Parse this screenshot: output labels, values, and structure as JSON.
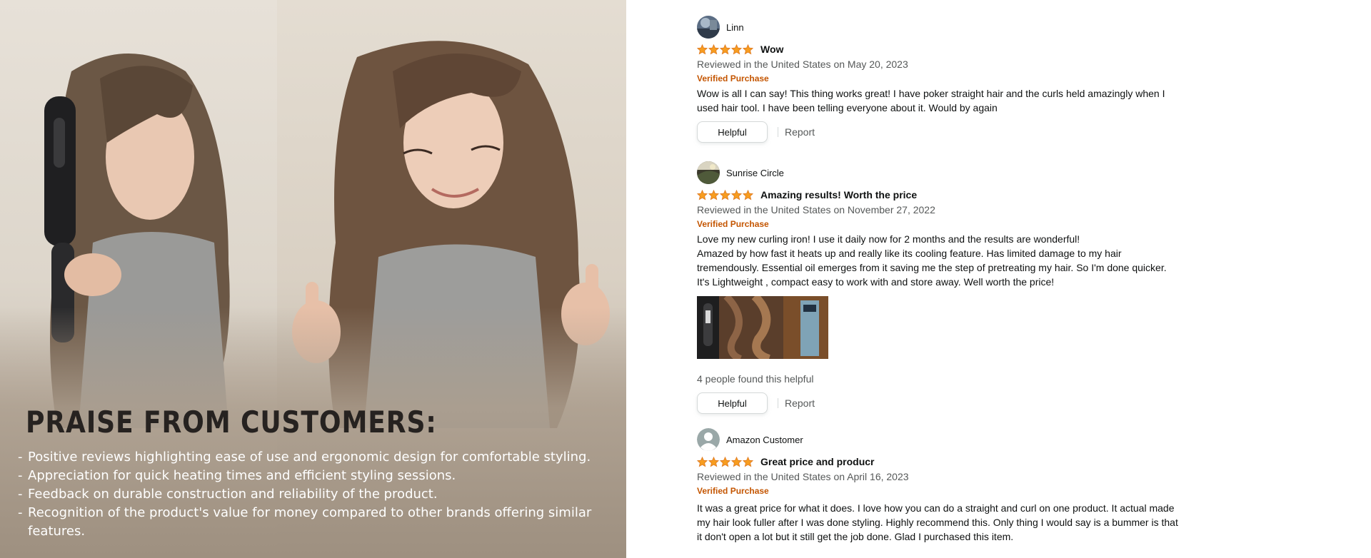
{
  "promo": {
    "title": "PRAISE FROM CUSTOMERS:",
    "points": [
      "Positive reviews highlighting ease of use and ergonomic design for comfortable styling.",
      "Appreciation for quick heating times and efficient styling sessions.",
      "Feedback on durable construction and reliability of the product.",
      "Recognition of the product's value for money compared to other brands offering similar features."
    ]
  },
  "colors": {
    "star": "#f79d20",
    "verified": "#c45500",
    "muted_text": "#565959",
    "button_border": "#d5d9d9"
  },
  "reviews": [
    {
      "profile_name": "Linn",
      "avatar": "photo-avatar",
      "rating": 5,
      "title": "Wow",
      "date": "Reviewed in the United States on May 20, 2023",
      "verified": "Verified Purchase",
      "body": [
        "Wow is all I can say! This thing works great! I have poker straight hair and the curls held amazingly when I used hair tool. I have been telling everyone about it. Would by again"
      ],
      "helpful_label": "Helpful",
      "report_label": "Report"
    },
    {
      "profile_name": "Sunrise Circle",
      "avatar": "photo-avatar",
      "rating": 5,
      "title": "Amazing results! Worth the price",
      "date": "Reviewed in the United States on November 27, 2022",
      "verified": "Verified Purchase",
      "body": [
        "Love my new curling iron! I use it daily now for 2 months and the results are wonderful!",
        "Amazed by how fast it heats up and really like its cooling feature. Has limited damage to my hair tremendously. Essential oil emerges from it saving me the step of pretreating my hair. So I'm done quicker.",
        "It's Lightweight , compact easy to work with and store away. Well worth the price!"
      ],
      "helpful_count": "4 people found this helpful",
      "helpful_label": "Helpful",
      "report_label": "Report"
    },
    {
      "profile_name": "Amazon Customer",
      "avatar": "default-user-icon",
      "rating": 5,
      "title": "Great price and producr",
      "date": "Reviewed in the United States on April 16, 2023",
      "verified": "Verified Purchase",
      "body": [
        "It was a great price for what it does. I love how you can do a straight and curl on one product. It actual made my hair look fuller after I was done styling. Highly recommend this. Only thing I would say is a bummer is that it don't open a lot but it still get the job done. Glad I purchased this item."
      ]
    }
  ]
}
